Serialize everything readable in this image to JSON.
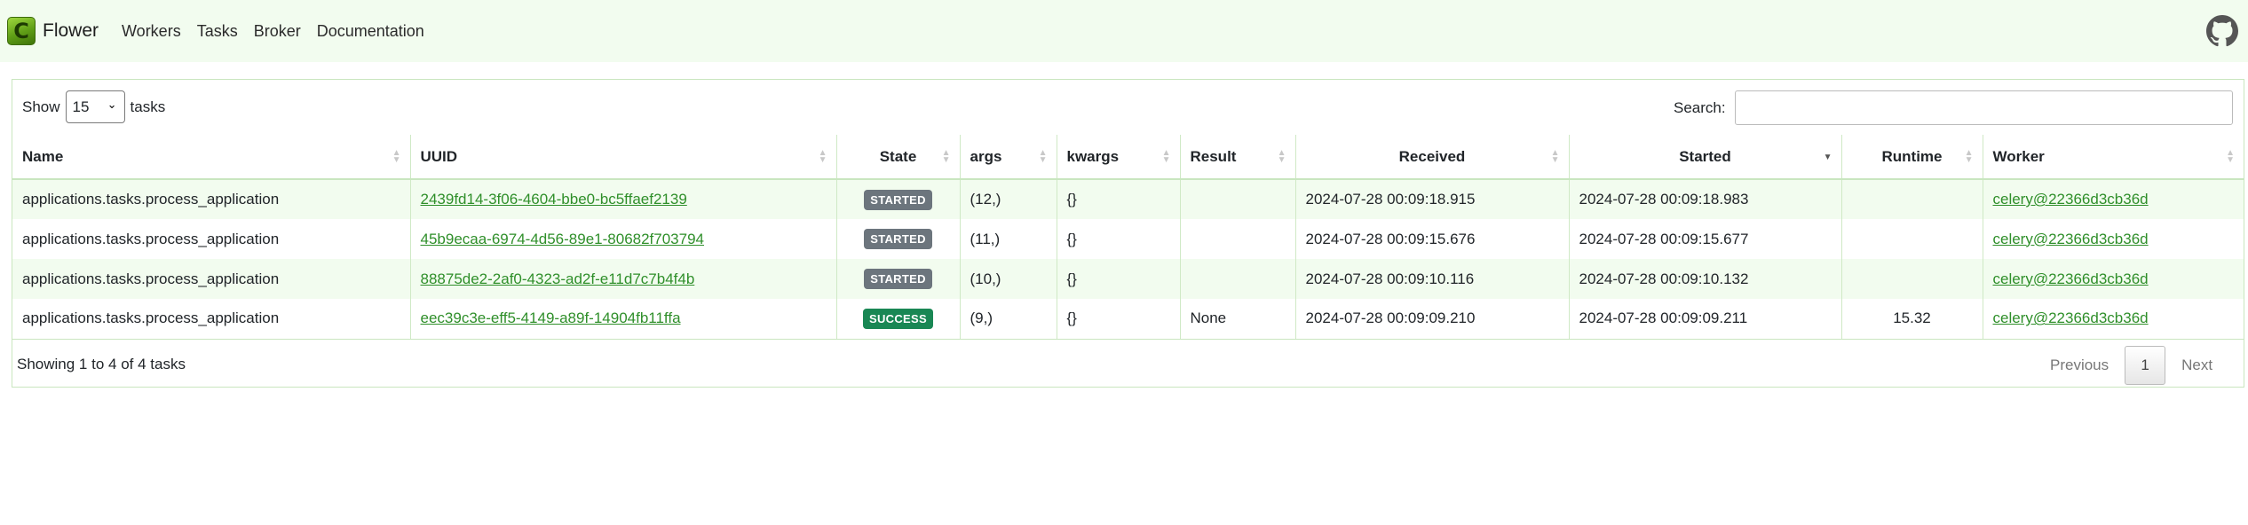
{
  "nav": {
    "brand": "Flower",
    "logo_letter": "C",
    "links": [
      "Workers",
      "Tasks",
      "Broker",
      "Documentation"
    ]
  },
  "controls": {
    "show_label": "Show",
    "page_size": "15",
    "tasks_label": "tasks",
    "search_label": "Search:",
    "search_value": ""
  },
  "table": {
    "headers": [
      "Name",
      "UUID",
      "State",
      "args",
      "kwargs",
      "Result",
      "Received",
      "Started",
      "Runtime",
      "Worker"
    ],
    "sorted_column": "Started",
    "sort_direction": "descending",
    "rows": [
      {
        "name": "applications.tasks.process_application",
        "uuid": "2439fd14-3f06-4604-bbe0-bc5ffaef2139",
        "state": "STARTED",
        "args": "(12,)",
        "kwargs": "{}",
        "result": "",
        "received": "2024-07-28 00:09:18.915",
        "started": "2024-07-28 00:09:18.983",
        "runtime": "",
        "worker": "celery@22366d3cb36d"
      },
      {
        "name": "applications.tasks.process_application",
        "uuid": "45b9ecaa-6974-4d56-89e1-80682f703794",
        "state": "STARTED",
        "args": "(11,)",
        "kwargs": "{}",
        "result": "",
        "received": "2024-07-28 00:09:15.676",
        "started": "2024-07-28 00:09:15.677",
        "runtime": "",
        "worker": "celery@22366d3cb36d"
      },
      {
        "name": "applications.tasks.process_application",
        "uuid": "88875de2-2af0-4323-ad2f-e11d7c7b4f4b",
        "state": "STARTED",
        "args": "(10,)",
        "kwargs": "{}",
        "result": "",
        "received": "2024-07-28 00:09:10.116",
        "started": "2024-07-28 00:09:10.132",
        "runtime": "",
        "worker": "celery@22366d3cb36d"
      },
      {
        "name": "applications.tasks.process_application",
        "uuid": "eec39c3e-eff5-4149-a89f-14904fb11ffa",
        "state": "SUCCESS",
        "args": "(9,)",
        "kwargs": "{}",
        "result": "None",
        "received": "2024-07-28 00:09:09.210",
        "started": "2024-07-28 00:09:09.211",
        "runtime": "15.32",
        "worker": "celery@22366d3cb36d"
      }
    ]
  },
  "footer": {
    "info": "Showing 1 to 4 of 4 tasks",
    "prev": "Previous",
    "current_page": "1",
    "next": "Next"
  },
  "colors": {
    "header_bg": "#f2fcef",
    "link": "#2f8f2a",
    "badge_started": "#6c757d",
    "badge_success": "#198754"
  },
  "icons": {
    "github": "github-icon",
    "sort": "sort-arrows-icon",
    "select": "chevron-down-icon"
  }
}
